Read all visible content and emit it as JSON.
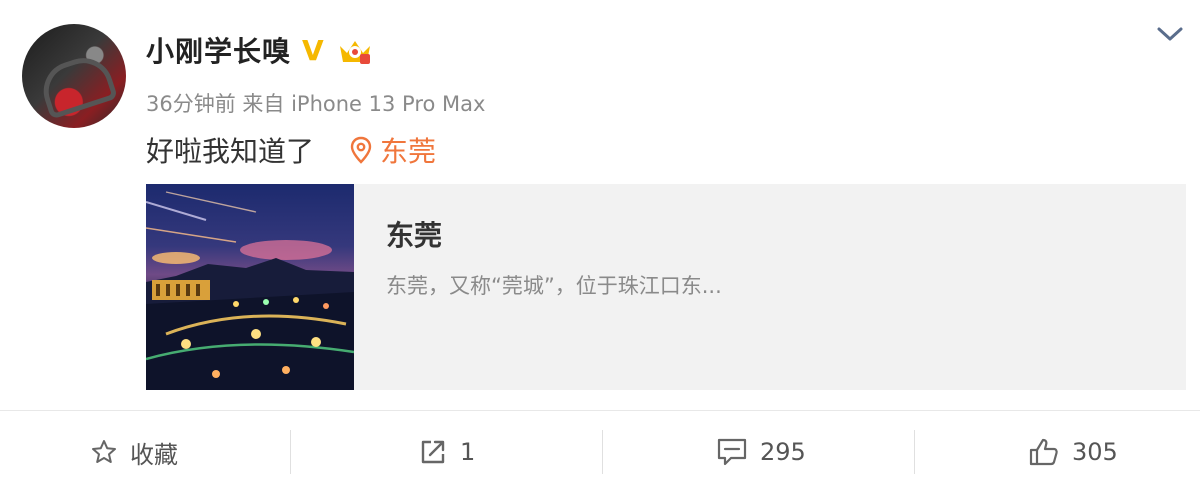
{
  "post": {
    "username": "小刚学长嗅",
    "verified_mark": "V",
    "meta": "36分钟前 来自 iPhone 13 Pro Max",
    "text": "好啦我知道了",
    "location": "东莞"
  },
  "card": {
    "title": "东莞",
    "description": "东莞，又称“莞城”，位于珠江口东..."
  },
  "actions": {
    "favorite_label": "收藏",
    "repost_count": "1",
    "comment_count": "295",
    "like_count": "305"
  },
  "colors": {
    "accent": "#f0763c",
    "verified": "#f5b800",
    "muted": "#8a8a8a"
  },
  "icons": {
    "avatar": "user-avatar",
    "dropdown": "chevron-down-icon",
    "location": "location-pin-icon",
    "favorite": "star-icon",
    "repost": "share-icon",
    "comment": "comment-icon",
    "like": "thumbs-up-icon"
  }
}
